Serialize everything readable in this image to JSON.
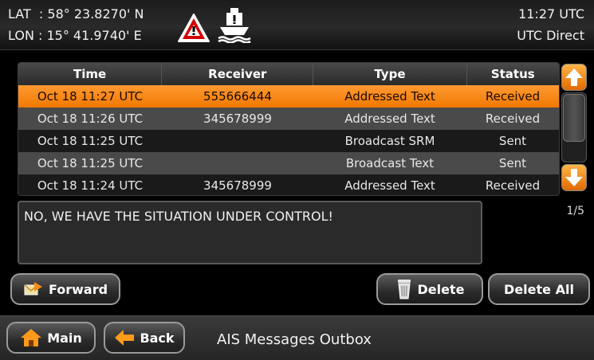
{
  "status": {
    "lat": "LAT  : 58° 23.8270' N",
    "lon": "LON : 15° 41.9740' E",
    "time": "11:27 UTC",
    "mode": "UTC Direct"
  },
  "icons": {
    "warning": "warning-triangle-icon",
    "ship": "ship-alert-icon",
    "scroll_up": "arrow-up-icon",
    "scroll_down": "arrow-down-icon",
    "forward": "forward-icon",
    "delete": "trash-icon",
    "main": "home-icon",
    "back": "arrow-left-icon"
  },
  "colors": {
    "accent": "#f07800",
    "warning": "#d40000"
  },
  "table": {
    "headers": {
      "time": "Time",
      "receiver": "Receiver",
      "type": "Type",
      "status": "Status"
    },
    "rows": [
      {
        "time": "Oct 18 11:27 UTC",
        "receiver": "555666444",
        "type": "Addressed Text",
        "status": "Received",
        "selected": true
      },
      {
        "time": "Oct 18 11:26 UTC",
        "receiver": "345678999",
        "type": "Addressed Text",
        "status": "Received"
      },
      {
        "time": "Oct 18 11:25 UTC",
        "receiver": "",
        "type": "Broadcast SRM",
        "status": "Sent"
      },
      {
        "time": "Oct 18 11:25 UTC",
        "receiver": "",
        "type": "Broadcast Text",
        "status": "Sent"
      },
      {
        "time": "Oct 18 11:24 UTC",
        "receiver": "345678999",
        "type": "Addressed Text",
        "status": "Received"
      }
    ]
  },
  "message": {
    "text": "NO, WE HAVE THE SITUATION UNDER CONTROL!",
    "page": "1/5"
  },
  "buttons": {
    "forward": "Forward",
    "delete": "Delete",
    "delete_all": "Delete All",
    "main": "Main",
    "back": "Back"
  },
  "screen_title": "AIS Messages Outbox"
}
